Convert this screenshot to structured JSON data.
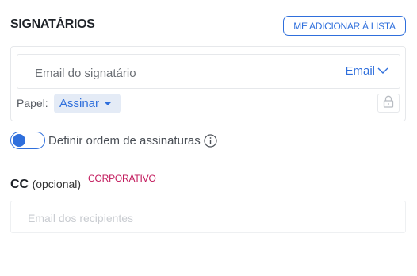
{
  "signers": {
    "title": "SIGNATÁRIOS",
    "add_me_label": "ME ADICIONAR À LISTA",
    "email_placeholder": "Email do signatário",
    "email_type": "Email",
    "role_label": "Papel:",
    "role_value": "Assinar"
  },
  "order": {
    "toggle_on": true,
    "label": "Definir ordem de assinaturas"
  },
  "cc": {
    "title": "CC",
    "optional": "(opcional)",
    "badge": "CORPORATIVO",
    "placeholder": "Email dos recipientes"
  },
  "icons": [
    "chevron-down-icon",
    "caret-down-icon",
    "lock-icon",
    "info-icon"
  ],
  "colors": {
    "accent": "#2f6fdc",
    "badge": "#c2185b",
    "role_bg": "#e4ebf6"
  }
}
